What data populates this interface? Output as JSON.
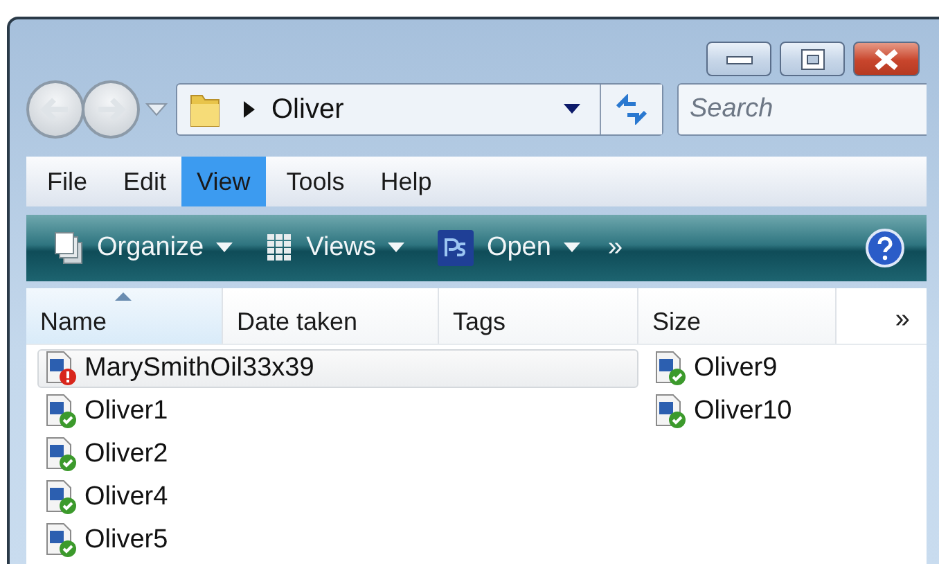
{
  "address": {
    "path": "Oliver"
  },
  "search": {
    "placeholder": "Search"
  },
  "menu": [
    {
      "label": "File",
      "selected": false
    },
    {
      "label": "Edit",
      "selected": false
    },
    {
      "label": "View",
      "selected": true
    },
    {
      "label": "Tools",
      "selected": false
    },
    {
      "label": "Help",
      "selected": false
    }
  ],
  "toolbar": {
    "items": [
      {
        "label": "Organize",
        "kind": "organize"
      },
      {
        "label": "Views",
        "kind": "views"
      },
      {
        "label": "Open",
        "kind": "open"
      }
    ],
    "overflow": "»"
  },
  "columns": {
    "items": [
      {
        "label": "Name",
        "sorted": true
      },
      {
        "label": "Date taken",
        "sorted": false
      },
      {
        "label": "Tags",
        "sorted": false
      },
      {
        "label": "Size",
        "sorted": false
      }
    ],
    "overflow": "»"
  },
  "files": [
    {
      "name": "MarySmithOil33x39",
      "error": true,
      "selected": true
    },
    {
      "name": "Oliver1",
      "error": false,
      "selected": false
    },
    {
      "name": "Oliver2",
      "error": false,
      "selected": false
    },
    {
      "name": "Oliver4",
      "error": false,
      "selected": false
    },
    {
      "name": "Oliver5",
      "error": false,
      "selected": false
    },
    {
      "name": "Oliver9",
      "error": false,
      "selected": false
    },
    {
      "name": "Oliver10",
      "error": false,
      "selected": false
    }
  ]
}
